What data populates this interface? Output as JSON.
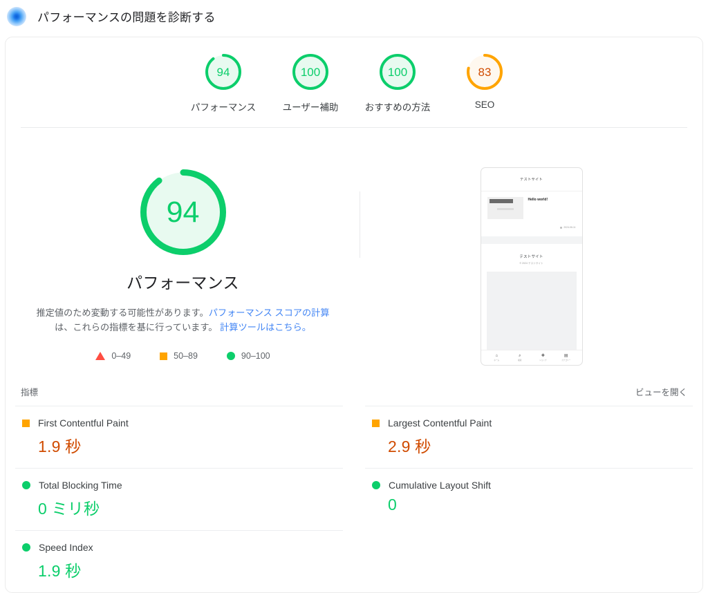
{
  "header": {
    "icon": "lighthouse-glow-icon",
    "title": "パフォーマンスの問題を診断する"
  },
  "category_scores": [
    {
      "value": "94",
      "label": "パフォーマンス",
      "color": "#0cce6b",
      "pct": 94
    },
    {
      "value": "100",
      "label": "ユーザー補助",
      "color": "#0cce6b",
      "pct": 100
    },
    {
      "value": "100",
      "label": "おすすめの方法",
      "color": "#0cce6b",
      "pct": 100
    },
    {
      "value": "83",
      "label": "SEO",
      "color": "#ffa400",
      "pct": 83
    }
  ],
  "main_gauge": {
    "value": "94",
    "title": "パフォーマンス",
    "color": "#0cce6b",
    "pct": 94
  },
  "description": {
    "part1": "推定値のため変動する可能性があります。",
    "link1": "パフォーマンス スコアの計算",
    "part2": "は、これらの指標を基に行っています。",
    "link2": "計算ツールはこちら。"
  },
  "legend": [
    {
      "shape": "triangle",
      "label": "0–49",
      "color": "#ff4e42"
    },
    {
      "shape": "square",
      "label": "50–89",
      "color": "#ffa400"
    },
    {
      "shape": "circle",
      "label": "90–100",
      "color": "#0cce6b"
    }
  ],
  "phone_preview": {
    "site_name": "テストサイト",
    "post_title": "Hello world!",
    "meta": "2024-06-11",
    "footer_title": "テストサイト",
    "footer_sub": "© 2024 テストサイト",
    "nav": [
      {
        "icon": "home-icon",
        "glyph": "⌂",
        "label": "ホーム"
      },
      {
        "icon": "search-icon",
        "glyph": "⌕",
        "label": "検索"
      },
      {
        "icon": "add-icon",
        "glyph": "✚",
        "label": "ショップ"
      },
      {
        "icon": "menu-icon",
        "glyph": "▤",
        "label": "カテゴリー"
      }
    ]
  },
  "metrics_section": {
    "label": "指標",
    "open_view_link": "ビューを開く"
  },
  "metrics": [
    {
      "name": "First Contentful Paint",
      "value": "1.9 秒",
      "status": "square",
      "color": "#ffa400"
    },
    {
      "name": "Largest Contentful Paint",
      "value": "2.9 秒",
      "status": "square",
      "color": "#ffa400"
    },
    {
      "name": "Total Blocking Time",
      "value": "0 ミリ秒",
      "status": "circle",
      "color": "#0cce6b"
    },
    {
      "name": "Cumulative Layout Shift",
      "value": "0",
      "status": "circle",
      "color": "#0cce6b"
    },
    {
      "name": "Speed Index",
      "value": "1.9 秒",
      "status": "circle",
      "color": "#0cce6b"
    }
  ]
}
